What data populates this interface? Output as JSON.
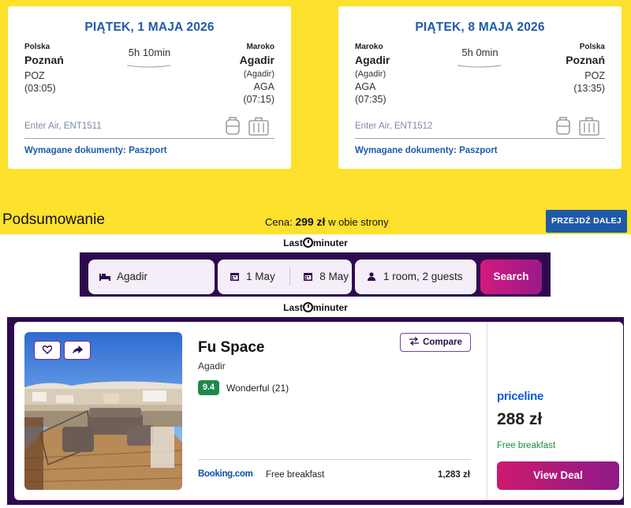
{
  "outbound": {
    "date": "PIĄTEK, 1 MAJA 2026",
    "from_country": "Polska",
    "from_city": "Poznań",
    "from_code": "POZ",
    "dep_time": "(03:05)",
    "duration": "5h 10min",
    "to_country": "Maroko",
    "to_city": "Agadir",
    "to_sub": "(Agadir)",
    "to_code": "AGA",
    "arr_time": "(07:15)",
    "carrier": "Enter Air, ENT1511",
    "docs": "Wymagane dokumenty: Paszport"
  },
  "inbound": {
    "date": "PIĄTEK, 8 MAJA 2026",
    "from_country": "Maroko",
    "from_city": "Agadir",
    "from_sub": "(Agadir)",
    "from_code": "AGA",
    "dep_time": "(07:35)",
    "duration": "5h 0min",
    "to_country": "Polska",
    "to_city": "Poznań",
    "to_code": "POZ",
    "arr_time": "(13:35)",
    "carrier": "Enter Air, ENT1512",
    "docs": "Wymagane dokumenty: Paszport"
  },
  "summary": {
    "title": "Podsumowanie",
    "price_prefix": "Cena: ",
    "price": "299 zł",
    "price_suffix": " w obie strony",
    "next_button": "PRZEJDŹ DALEJ"
  },
  "lastminute": {
    "logo_left": "Last",
    "logo_right": "minuter"
  },
  "search": {
    "destination": "Agadir",
    "checkin": "1 May",
    "checkout": "8 May",
    "guests": "1 room, 2 guests",
    "button": "Search"
  },
  "hotel": {
    "name": "Fu Space",
    "location": "Agadir",
    "score": "9.4",
    "score_text": "Wonderful (21)",
    "compare": "Compare",
    "booking_provider": "Booking.com",
    "booking_breakfast": "Free breakfast",
    "booking_price": "1,283 zł",
    "featured_provider": "priceline",
    "featured_price": "288 zł",
    "featured_breakfast": "Free breakfast",
    "view_deal": "View Deal"
  },
  "colors": {
    "yellow": "#fde12c",
    "blue": "#1f5aa8",
    "purple": "#2d0a4e",
    "pink": "#cc1a6e",
    "green": "#1b8a4c"
  },
  "icons": [
    "backpack-icon",
    "suitcase-icon",
    "bed-icon",
    "calendar-icon",
    "person-icon",
    "heart-icon",
    "share-icon",
    "compare-icon"
  ]
}
